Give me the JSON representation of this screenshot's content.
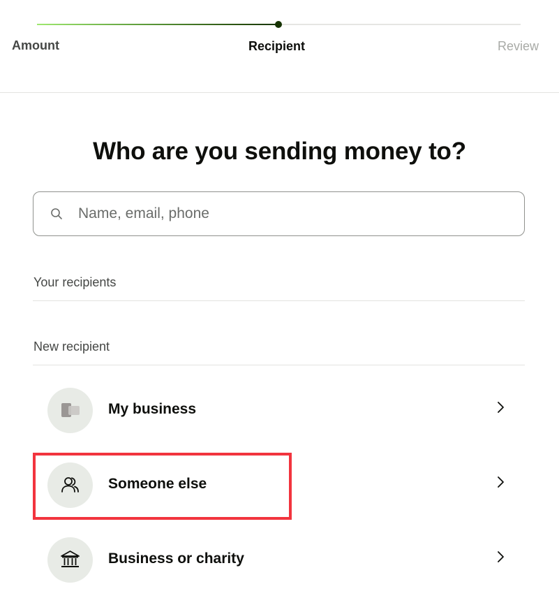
{
  "stepper": {
    "steps": [
      {
        "label": "Amount",
        "state": "done"
      },
      {
        "label": "Recipient",
        "state": "current"
      },
      {
        "label": "Review",
        "state": "upcoming"
      }
    ]
  },
  "main": {
    "title": "Who are you sending money to?",
    "search": {
      "placeholder": "Name, email, phone",
      "value": ""
    },
    "your_recipients_label": "Your recipients",
    "new_recipient_label": "New recipient",
    "options": [
      {
        "label": "My business",
        "icon": "business-logo-icon"
      },
      {
        "label": "Someone else",
        "icon": "people-icon"
      },
      {
        "label": "Business or charity",
        "icon": "bank-icon"
      }
    ]
  },
  "colors": {
    "progress_start": "#9fe870",
    "progress_end": "#163300",
    "highlight": "#f2343e",
    "avatar_bg": "#e8ebe6"
  }
}
